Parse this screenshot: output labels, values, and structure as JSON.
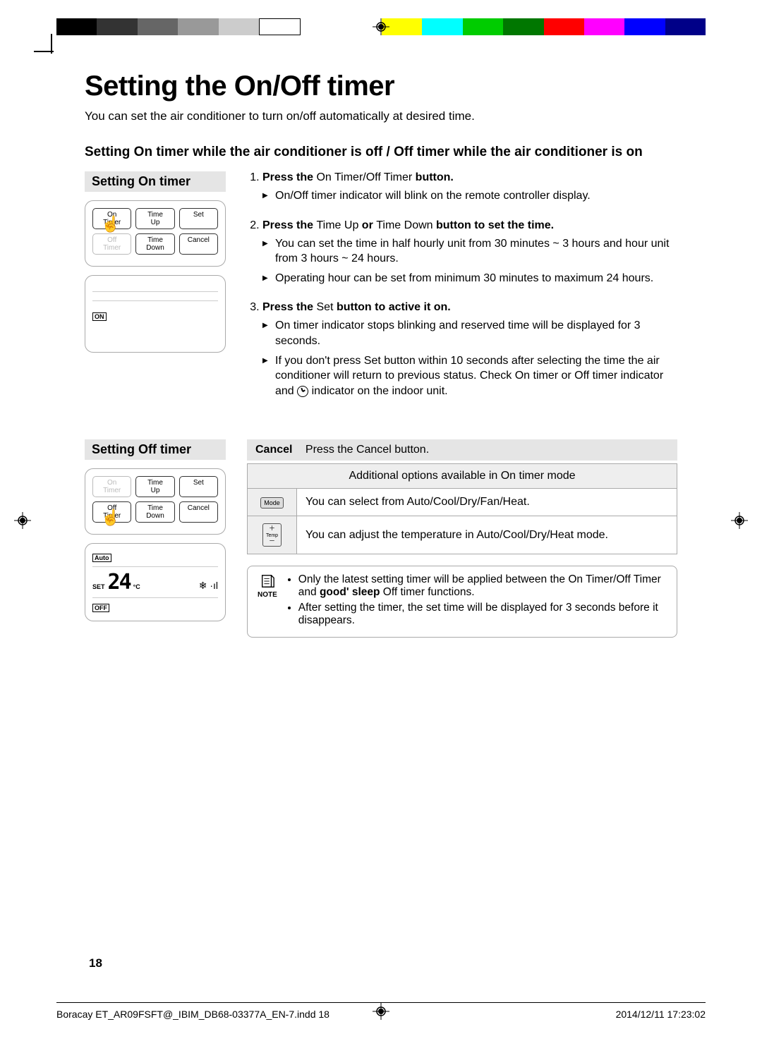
{
  "title": "Setting the On/Off timer",
  "intro": "You can set the air conditioner to turn on/off automatically at desired time.",
  "subheading": "Setting On timer while the air conditioner is off / Off timer while the air conditioner is on",
  "on_section_title": "Setting On timer",
  "off_section_title": "Setting Off timer",
  "remote_buttons": {
    "on_timer": "On\nTimer",
    "time_up": "Time\nUp",
    "set": "Set",
    "off_timer": "Off\nTimer",
    "time_down": "Time\nDown",
    "cancel": "Cancel"
  },
  "display_on": {
    "badge": "ON"
  },
  "display_off": {
    "auto": "Auto",
    "set_label": "SET",
    "temp": "24",
    "unit": "°C",
    "off_badge": "OFF"
  },
  "steps": [
    {
      "main_pre": "Press the ",
      "main_reg": "On Timer/Off Timer",
      "main_post": " button.",
      "bullets": [
        "On/Off timer indicator will blink on the remote controller display."
      ]
    },
    {
      "main_pre": "Press the ",
      "main_reg": "Time Up",
      "main_mid": " or ",
      "main_reg2": "Time Down",
      "main_post": " button to set the time.",
      "bullets": [
        "You can set the time in half hourly unit from 30 minutes ~ 3 hours and hour unit from 3 hours ~ 24 hours.",
        "Operating hour can be set from minimum 30 minutes to maximum 24 hours."
      ]
    },
    {
      "main_pre": "Press the ",
      "main_reg": "Set",
      "main_post": " button to active it on.",
      "bullets": [
        "On timer indicator stops blinking and reserved time will be displayed for 3 seconds.",
        "If you don't press Set button within 10 seconds after selecting the time the air conditioner will return to previous status. Check On timer or Off timer indicator and  {clock} indicator on the indoor unit."
      ]
    }
  ],
  "cancel": {
    "label": "Cancel",
    "text": "Press the Cancel button."
  },
  "options_header": "Additional options available in On timer mode",
  "options": [
    {
      "btn": "Mode",
      "desc": "You can select from Auto/Cool/Dry/Fan/Heat."
    },
    {
      "btn": "Temp",
      "desc": "You can adjust the temperature in Auto/Cool/Dry/Heat mode."
    }
  ],
  "note_label": "NOTE",
  "notes": [
    "Only the latest setting timer will be applied between the On Timer/Off Timer and good' sleep Off timer functions.",
    "After setting the timer, the set time will be displayed for 3 seconds before it disappears."
  ],
  "pagenum": "18",
  "footer_left": "Boracay ET_AR09FSFT@_IBIM_DB68-03377A_EN-7.indd   18",
  "footer_right": "2014/12/11   17:23:02"
}
